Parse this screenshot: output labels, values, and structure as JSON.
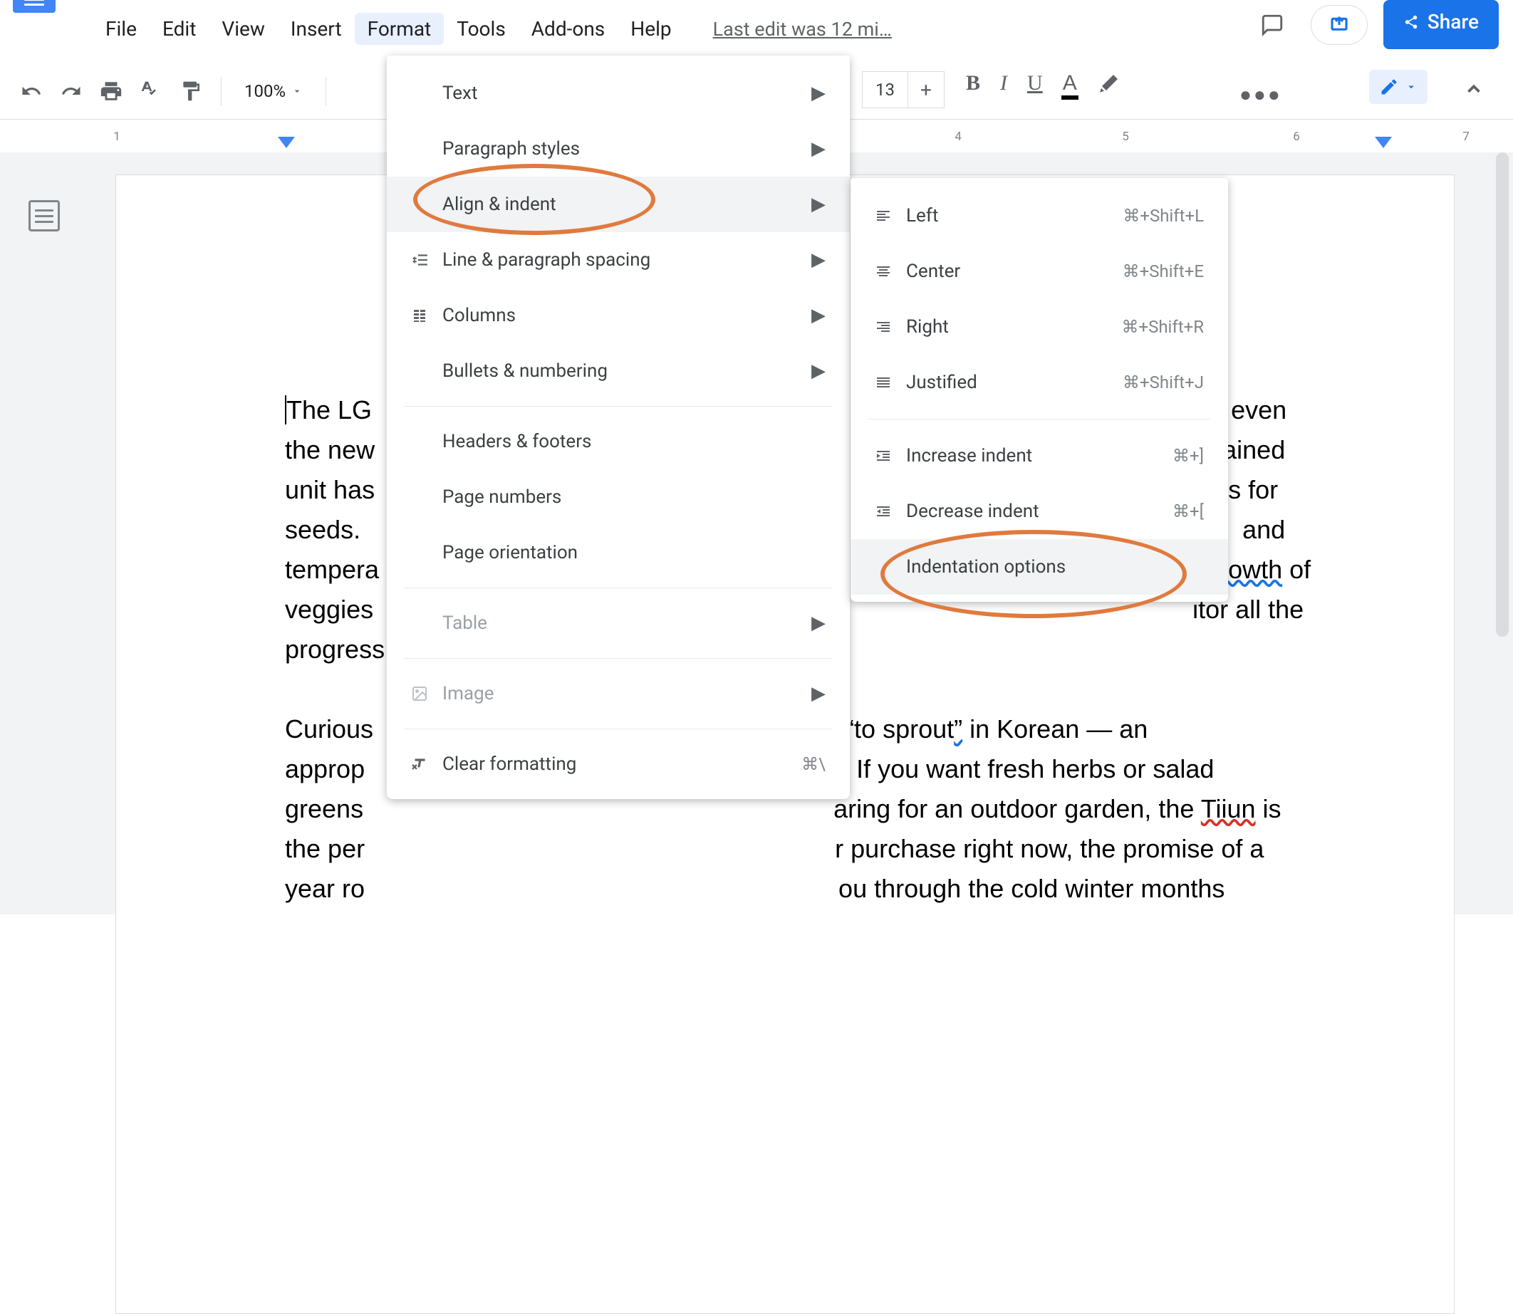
{
  "menubar": {
    "items": [
      "File",
      "Edit",
      "View",
      "Insert",
      "Format",
      "Tools",
      "Add-ons",
      "Help"
    ],
    "active_index": 4,
    "last_edit": "Last edit was 12 mi…"
  },
  "share_label": "Share",
  "toolbar": {
    "zoom": "100%",
    "font_size": "13"
  },
  "ruler": {
    "labels": [
      "1",
      "4",
      "5",
      "6",
      "7"
    ]
  },
  "format_menu": {
    "items": [
      {
        "label": "Text",
        "submenu": true
      },
      {
        "label": "Paragraph styles",
        "submenu": true
      },
      {
        "label": "Align & indent",
        "submenu": true,
        "hover": true
      },
      {
        "label": "Line & paragraph spacing",
        "icon": "line-spacing-icon",
        "submenu": true
      },
      {
        "label": "Columns",
        "icon": "columns-icon",
        "submenu": true
      },
      {
        "label": "Bullets & numbering",
        "submenu": true
      },
      {
        "sep": true
      },
      {
        "label": "Headers & footers"
      },
      {
        "label": "Page numbers"
      },
      {
        "label": "Page orientation"
      },
      {
        "sep": true
      },
      {
        "label": "Table",
        "submenu": true,
        "disabled": true
      },
      {
        "sep": true
      },
      {
        "label": "Image",
        "icon": "image-icon",
        "submenu": true,
        "disabled": true
      },
      {
        "sep": true
      },
      {
        "label": "Clear formatting",
        "icon": "clear-format-icon",
        "shortcut": "⌘\\"
      }
    ]
  },
  "align_menu": {
    "items": [
      {
        "label": "Left",
        "icon": "align-left-icon",
        "shortcut": "⌘+Shift+L"
      },
      {
        "label": "Center",
        "icon": "align-center-icon",
        "shortcut": "⌘+Shift+E"
      },
      {
        "label": "Right",
        "icon": "align-right-icon",
        "shortcut": "⌘+Shift+R"
      },
      {
        "label": "Justified",
        "icon": "align-justify-icon",
        "shortcut": "⌘+Shift+J"
      },
      {
        "sep": true
      },
      {
        "label": "Increase indent",
        "icon": "indent-increase-icon",
        "shortcut": "⌘+]"
      },
      {
        "label": "Decrease indent",
        "icon": "indent-decrease-icon",
        "shortcut": "⌘+["
      },
      {
        "label": "Indentation options",
        "hover": true
      }
    ]
  },
  "document": {
    "p1_seg1": "The LG",
    "p1_seg2": "ielp even",
    "p1_line2a": "the new",
    "p1_line2b": "ontained",
    "p1_line3a": "unit has",
    "p1_line3b": "holes for",
    "p1_line4a": "seeds.",
    "p1_line4b": "and",
    "p1_line5a": "tempera",
    "p1_line5b_word": "growth",
    "p1_line5b_rest": " of",
    "p1_line6a": "veggies",
    "p1_line6b": "itor all the",
    "p1_line7a": "progress",
    "p2_line1a": "Curious",
    "p2_line1b": "s “to sprout",
    "p2_line1b_word": "”",
    "p2_line1b_rest": " in Korean — an",
    "p2_line2a": "approp",
    "p2_line2b": "e. If you want fresh herbs or salad",
    "p2_line3a": "greens",
    "p2_line3b_pre": "aring for an outdoor garden, the ",
    "p2_line3b_word": "Tiiun",
    "p2_line3b_post": " is",
    "p2_line4a": "the per",
    "p2_line4b": "r purchase right now, the promise of a",
    "p2_line5a": "year ro",
    "p2_line5b": "ou through the cold winter months"
  }
}
